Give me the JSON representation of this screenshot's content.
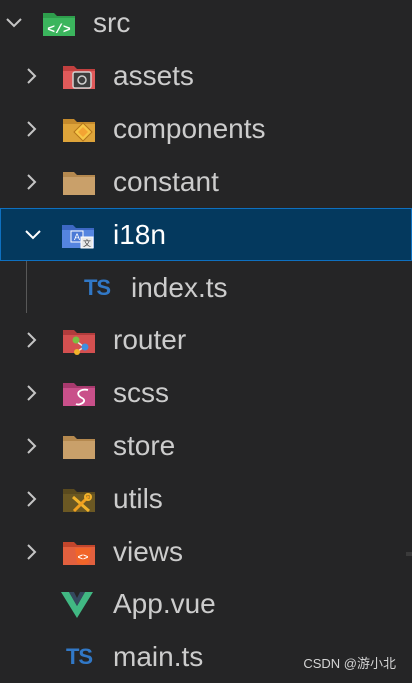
{
  "explorer": {
    "root": {
      "label": "src",
      "icon": "folder-src-icon",
      "expanded": true
    },
    "items": [
      {
        "label": "assets",
        "icon": "folder-assets-icon",
        "type": "folder",
        "expanded": false
      },
      {
        "label": "components",
        "icon": "folder-components-icon",
        "type": "folder",
        "expanded": false
      },
      {
        "label": "constant",
        "icon": "folder-icon",
        "type": "folder",
        "expanded": false
      },
      {
        "label": "i18n",
        "icon": "folder-i18n-icon",
        "type": "folder",
        "expanded": true,
        "selected": true
      },
      {
        "label": "index.ts",
        "icon": "typescript-file-icon",
        "type": "file",
        "badge": "TS"
      },
      {
        "label": "router",
        "icon": "folder-router-icon",
        "type": "folder",
        "expanded": false
      },
      {
        "label": "scss",
        "icon": "folder-scss-icon",
        "type": "folder",
        "expanded": false
      },
      {
        "label": "store",
        "icon": "folder-icon",
        "type": "folder",
        "expanded": false
      },
      {
        "label": "utils",
        "icon": "folder-utils-icon",
        "type": "folder",
        "expanded": false
      },
      {
        "label": "views",
        "icon": "folder-views-icon",
        "type": "folder",
        "expanded": false
      },
      {
        "label": "App.vue",
        "icon": "vue-file-icon",
        "type": "file"
      },
      {
        "label": "main.ts",
        "icon": "typescript-file-icon",
        "type": "file",
        "badge": "TS"
      }
    ]
  },
  "watermark": "CSDN @游小北",
  "colors": {
    "background": "#252526",
    "selected_bg": "#04395e",
    "selected_border": "#0e70c0",
    "text": "#cccccc",
    "typescript": "#3178c6",
    "vue_green": "#41b883",
    "vue_dark": "#34495e"
  }
}
